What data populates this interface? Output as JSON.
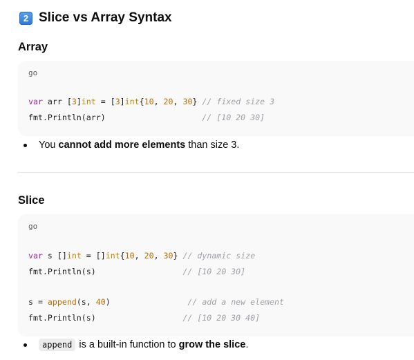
{
  "heading": {
    "number": "2",
    "title": "Slice vs Array Syntax"
  },
  "array_section": {
    "title": "Array",
    "code": {
      "lang": "go",
      "line1": {
        "kw": "var",
        "name": " arr [",
        "len": "3",
        "mid1": "]",
        "type1": "int",
        "mid2": " = [",
        "len2": "3",
        "mid3": "]",
        "type2": "int",
        "mid4": "{",
        "n1": "10",
        "sep1": ", ",
        "n2": "20",
        "sep2": ", ",
        "n3": "30",
        "end": "} ",
        "comment": "// fixed size 3"
      },
      "line2": {
        "code": "fmt.Println(arr)",
        "pad": "                    ",
        "comment": "// [10 20 30]"
      }
    },
    "bullet": {
      "before": "You ",
      "bold": "cannot add more elements",
      "after": " than size 3."
    }
  },
  "slice_section": {
    "title": "Slice",
    "code": {
      "lang": "go",
      "line1": {
        "kw": "var",
        "name": " s []",
        "type1": "int",
        "mid2": " = []",
        "type2": "int",
        "mid4": "{",
        "n1": "10",
        "sep1": ", ",
        "n2": "20",
        "sep2": ", ",
        "n3": "30",
        "end": "} ",
        "comment": "// dynamic size"
      },
      "line2": {
        "code": "fmt.Println(s)",
        "pad": "                  ",
        "comment": "// [10 20 30]"
      },
      "line3": {
        "pre": "s = ",
        "fn": "append",
        "open": "(s, ",
        "num": "40",
        "close": ")",
        "pad": "                ",
        "comment": "// add a new element"
      },
      "line4": {
        "code": "fmt.Println(s)",
        "pad": "                  ",
        "comment": "// [10 20 30 40]"
      }
    },
    "bullet": {
      "code": "append",
      "middle": "is a built-in function to ",
      "bold": "grow the slice",
      "after": "."
    }
  },
  "colors": {
    "keyword": "#a626a4",
    "type": "#c18401",
    "number": "#b76b01",
    "comment": "#a0a1a7",
    "badge": "#2b78d6"
  }
}
